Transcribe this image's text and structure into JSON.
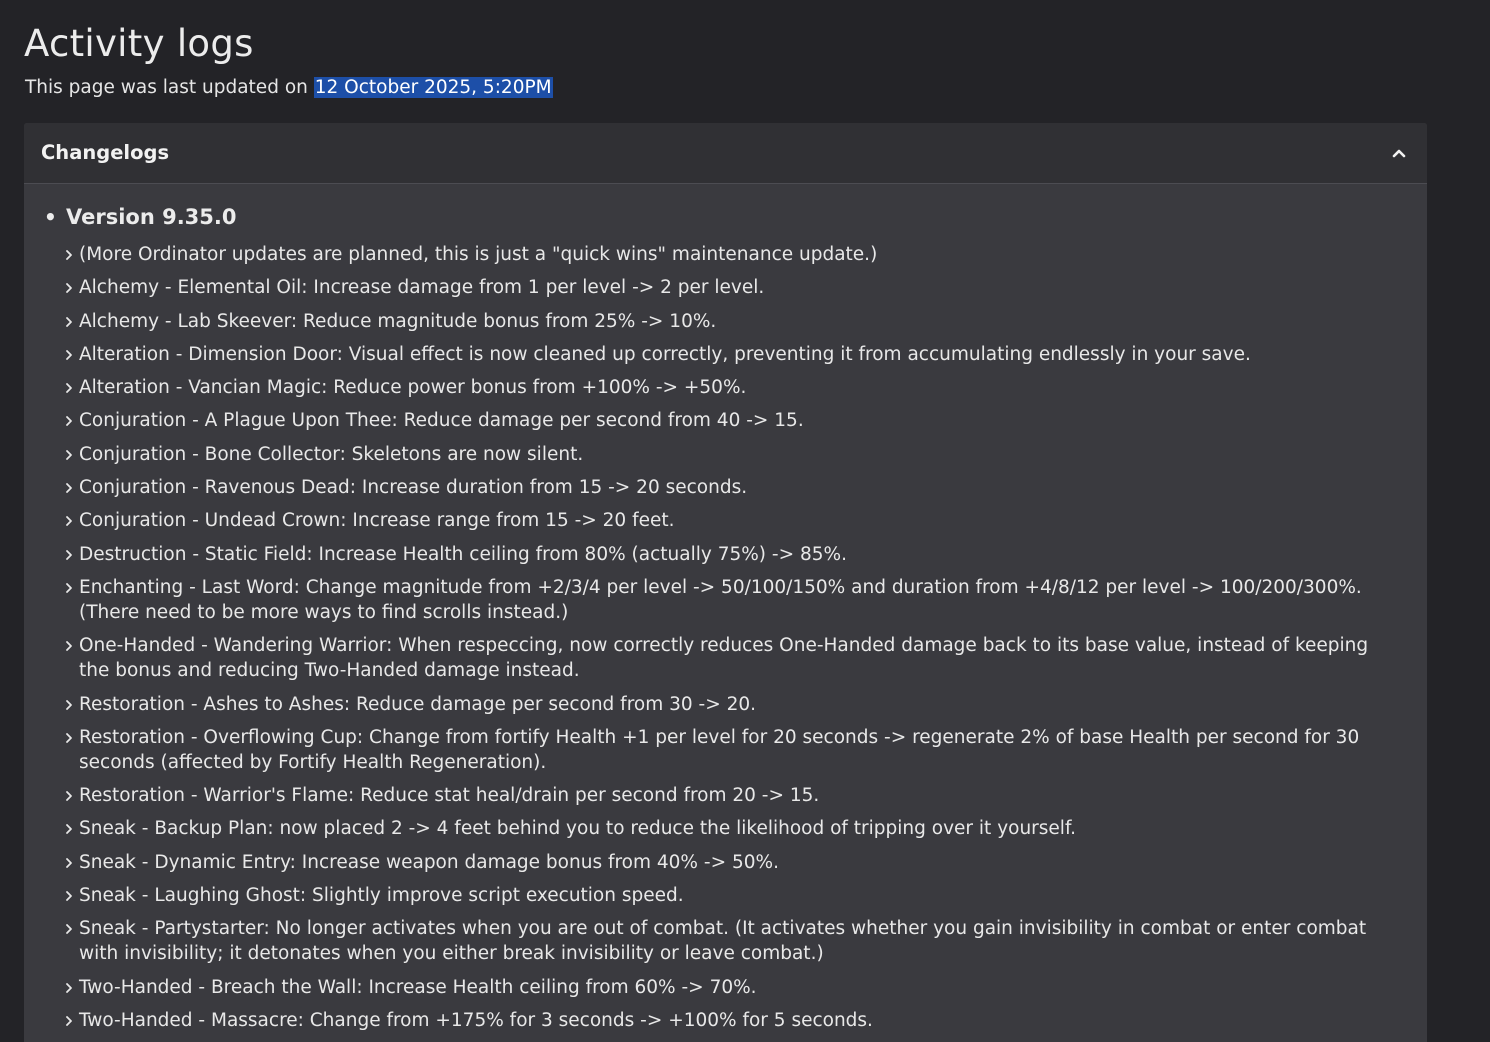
{
  "page": {
    "title": "Activity logs",
    "updated_prefix": "This page was last updated on ",
    "updated_date": "12 October 2025, 5:20PM"
  },
  "panel": {
    "title": "Changelogs",
    "collapse_icon": "chevron-up-icon",
    "version": "Version 9.35.0",
    "item_icon": "chevron-right-icon",
    "items": [
      "(More Ordinator updates are planned, this is just a \"quick wins\" maintenance update.)",
      "Alchemy - Elemental Oil: Increase damage from 1 per level -> 2 per level.",
      "Alchemy - Lab Skeever: Reduce magnitude bonus from 25% -> 10%.",
      "Alteration - Dimension Door: Visual effect is now cleaned up correctly, preventing it from accumulating endlessly in your save.",
      "Alteration - Vancian Magic: Reduce power bonus from +100% -> +50%.",
      "Conjuration - A Plague Upon Thee: Reduce damage per second from 40 -> 15.",
      "Conjuration - Bone Collector: Skeletons are now silent.",
      "Conjuration - Ravenous Dead: Increase duration from 15 -> 20 seconds.",
      "Conjuration - Undead Crown: Increase range from 15 -> 20 feet.",
      "Destruction - Static Field: Increase Health ceiling from 80% (actually 75%) -> 85%.",
      "Enchanting - Last Word: Change magnitude from +2/3/4 per level -> 50/100/150% and duration from +4/8/12 per level -> 100/200/300%. (There need to be more ways to find scrolls instead.)",
      "One-Handed - Wandering Warrior: When respeccing, now correctly reduces One-Handed damage back to its base value, instead of keeping the bonus and reducing Two-Handed damage instead.",
      "Restoration - Ashes to Ashes: Reduce damage per second from 30 -> 20.",
      "Restoration - Overflowing Cup: Change from fortify Health +1 per level for 20 seconds -> regenerate 2% of base Health per second for 30 seconds (affected by Fortify Health Regeneration).",
      "Restoration - Warrior's Flame: Reduce stat heal/drain per second from 20 -> 15.",
      "Sneak - Backup Plan: now placed 2 -> 4 feet behind you to reduce the likelihood of tripping over it yourself.",
      "Sneak - Dynamic Entry: Increase weapon damage bonus from 40% -> 50%.",
      "Sneak - Laughing Ghost: Slightly improve script execution speed.",
      "Sneak - Partystarter: No longer activates when you are out of combat. (It activates whether you gain invisibility in combat or enter combat with invisibility; it detonates when you either break invisibility or leave combat.)",
      "Two-Handed - Breach the Wall: Increase Health ceiling from 60% -> 70%.",
      "Two-Handed - Massacre: Change from +175% for 3 seconds -> +100% for 5 seconds."
    ]
  }
}
